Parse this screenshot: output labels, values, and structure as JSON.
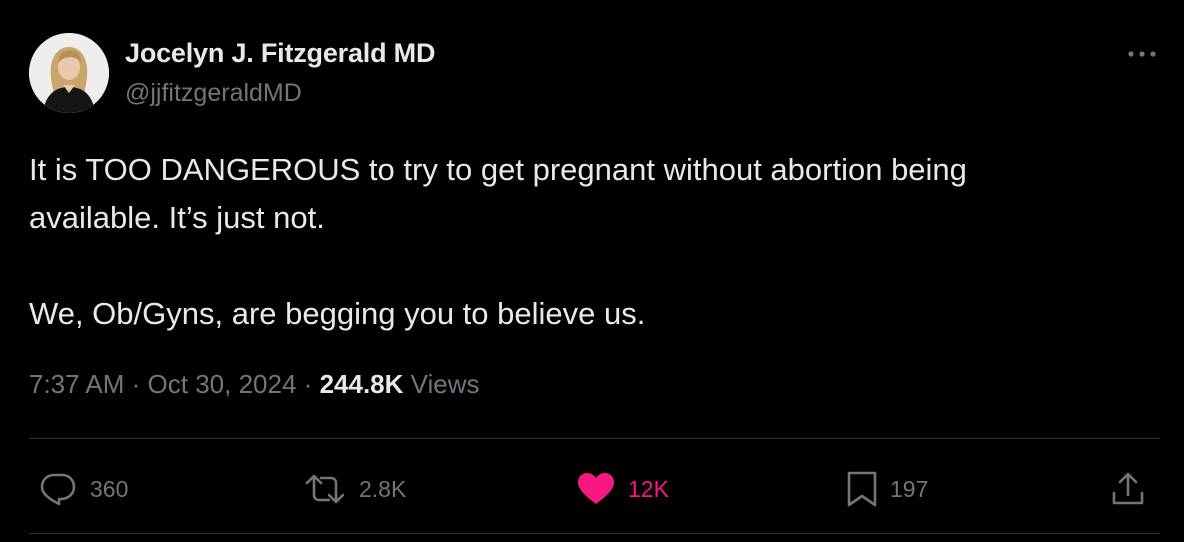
{
  "tweet": {
    "author": {
      "display_name": "Jocelyn J. Fitzgerald MD",
      "handle": "@jjfitzgeraldMD"
    },
    "text": {
      "line1": "It is TOO DANGEROUS to try to get pregnant without abortion being",
      "line2": "available. It’s just not.",
      "line3": "We, Ob/Gyns, are begging you to believe us."
    },
    "meta": {
      "time": "7:37 AM",
      "separator": "·",
      "date": "Oct 30, 2024",
      "views_count": "244.8K",
      "views_label": "Views"
    },
    "actions": {
      "replies": "360",
      "reposts": "2.8K",
      "likes": "12K",
      "bookmarks": "197"
    },
    "colors": {
      "background": "#000000",
      "text": "#e7e9ea",
      "secondary": "#71767b",
      "like_accent": "#f91880",
      "divider": "#2f3336"
    },
    "icons": {
      "more": "more-icon",
      "reply": "reply-icon",
      "repost": "repost-icon",
      "like": "heart-icon",
      "bookmark": "bookmark-icon",
      "share": "share-icon"
    }
  }
}
